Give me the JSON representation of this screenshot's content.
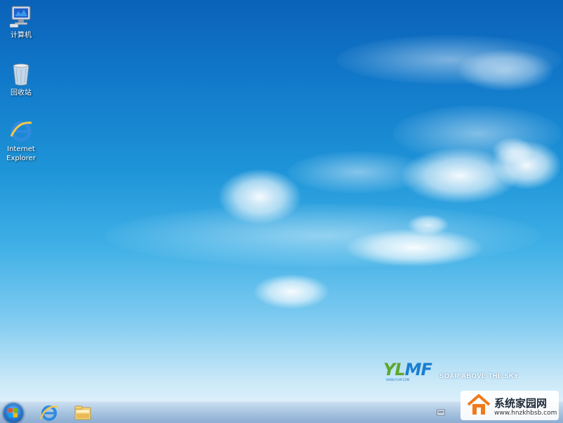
{
  "desktop": {
    "icons": [
      {
        "label": "计算机",
        "icon": "computer-icon"
      },
      {
        "label": "回收站",
        "icon": "recycle-bin-icon"
      },
      {
        "label": "Internet Explorer",
        "icon": "internet-explorer-icon"
      }
    ],
    "wallpaper": {
      "brand_left": "YL",
      "brand_right": "MF",
      "tagline": "SOAR ABOVE THE SKY",
      "url": "WWW.YLMF.COM"
    }
  },
  "taskbar": {
    "start_label": "Start",
    "pinned": [
      {
        "name": "Internet Explorer",
        "icon": "internet-explorer-icon"
      },
      {
        "name": "Windows Explorer",
        "icon": "folder-icon"
      }
    ],
    "tray_icons": [
      "keyboard-icon"
    ]
  },
  "watermark": {
    "title": "系统家园网",
    "url": "www.hnzkhbsb.com"
  },
  "colors": {
    "sky_top": "#0a62b8",
    "sky_bottom": "#eef7fd",
    "brand_green": "#5fa72b",
    "brand_blue": "#1b7fd0"
  }
}
